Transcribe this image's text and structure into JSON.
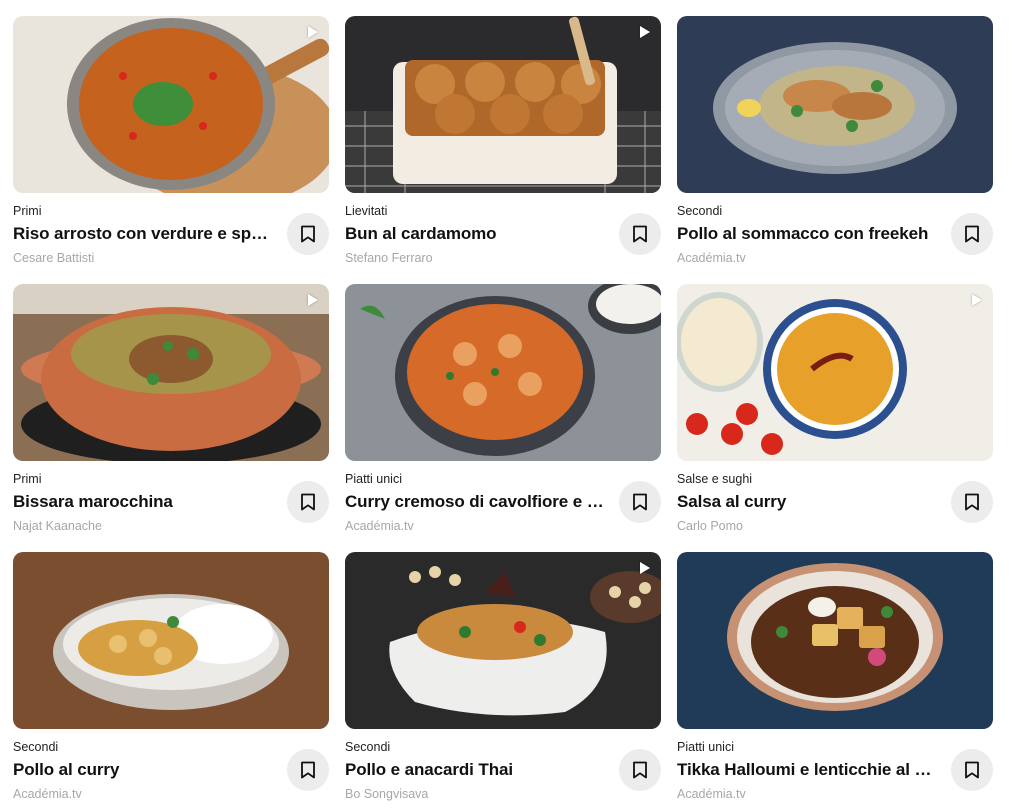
{
  "cards": [
    {
      "category": "Primi",
      "title": "Riso arrosto con verdure e spezie",
      "author": "Cesare Battisti",
      "has_video": true,
      "image": "rice-pot-icon"
    },
    {
      "category": "Lievitati",
      "title": "Bun al cardamomo",
      "author": "Stefano Ferraro",
      "has_video": true,
      "image": "bread-buns-icon"
    },
    {
      "category": "Secondi",
      "title": "Pollo al sommacco con freekeh",
      "author": "Académia.tv",
      "has_video": false,
      "image": "chicken-plate-icon"
    },
    {
      "category": "Primi",
      "title": "Bissara marocchina",
      "author": "Najat Kaanache",
      "has_video": true,
      "image": "clay-pot-soup-icon"
    },
    {
      "category": "Piatti unici",
      "title": "Curry cremoso di cavolfiore e hal…",
      "author": "Académia.tv",
      "has_video": false,
      "image": "cauliflower-curry-icon"
    },
    {
      "category": "Salse e sughi",
      "title": "Salsa al curry",
      "author": "Carlo Pomo",
      "has_video": true,
      "image": "curry-sauce-icon"
    },
    {
      "category": "Secondi",
      "title": "Pollo al curry",
      "author": "Académia.tv",
      "has_video": false,
      "image": "chicken-curry-rice-icon"
    },
    {
      "category": "Secondi",
      "title": "Pollo e anacardi Thai",
      "author": "Bo Songvisava",
      "has_video": true,
      "image": "cashew-chicken-icon"
    },
    {
      "category": "Piatti unici",
      "title": "Tikka Halloumi e lenticchie al cu…",
      "author": "Académia.tv",
      "has_video": false,
      "image": "halloumi-lentils-icon"
    }
  ],
  "colors": {
    "bookmark_bg": "#ececec",
    "author_text": "#a7a7a7"
  }
}
